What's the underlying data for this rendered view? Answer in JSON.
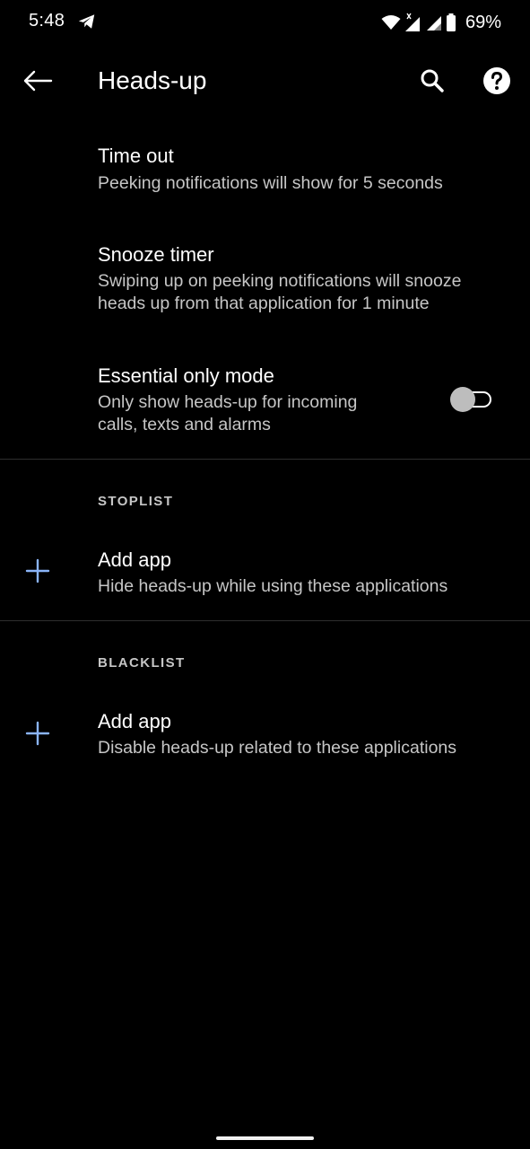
{
  "status_bar": {
    "time": "5:48",
    "battery": "69%",
    "icons": [
      "telegram-icon",
      "wifi-icon",
      "signal-icon",
      "signal-icon",
      "battery-icon"
    ]
  },
  "app_bar": {
    "title": "Heads-up",
    "icons": [
      "back-arrow-icon",
      "search-icon",
      "help-icon"
    ]
  },
  "settings": {
    "timeout": {
      "title": "Time out",
      "summary": "Peeking notifications will show for 5 seconds"
    },
    "snooze": {
      "title": "Snooze timer",
      "summary_line1": "Swiping up on peeking notifications will snooze",
      "summary_line2": "heads up from that application for 1 minute"
    },
    "essential": {
      "title": "Essential only mode",
      "summary_line1": "Only show heads-up for incoming",
      "summary_line2": "calls, texts and alarms",
      "enabled": false
    }
  },
  "stoplist": {
    "header": "STOPLIST",
    "add_title": "Add app",
    "add_summary": "Hide heads-up while using these applications"
  },
  "blacklist": {
    "header": "BLACKLIST",
    "add_title": "Add app",
    "add_summary": "Disable heads-up related to these applications"
  },
  "colors": {
    "background": "#000000",
    "accent_plus": "#8ab4f8",
    "secondary_text": "#c6c6c6",
    "toggle_thumb_off": "#bdbdbd"
  }
}
